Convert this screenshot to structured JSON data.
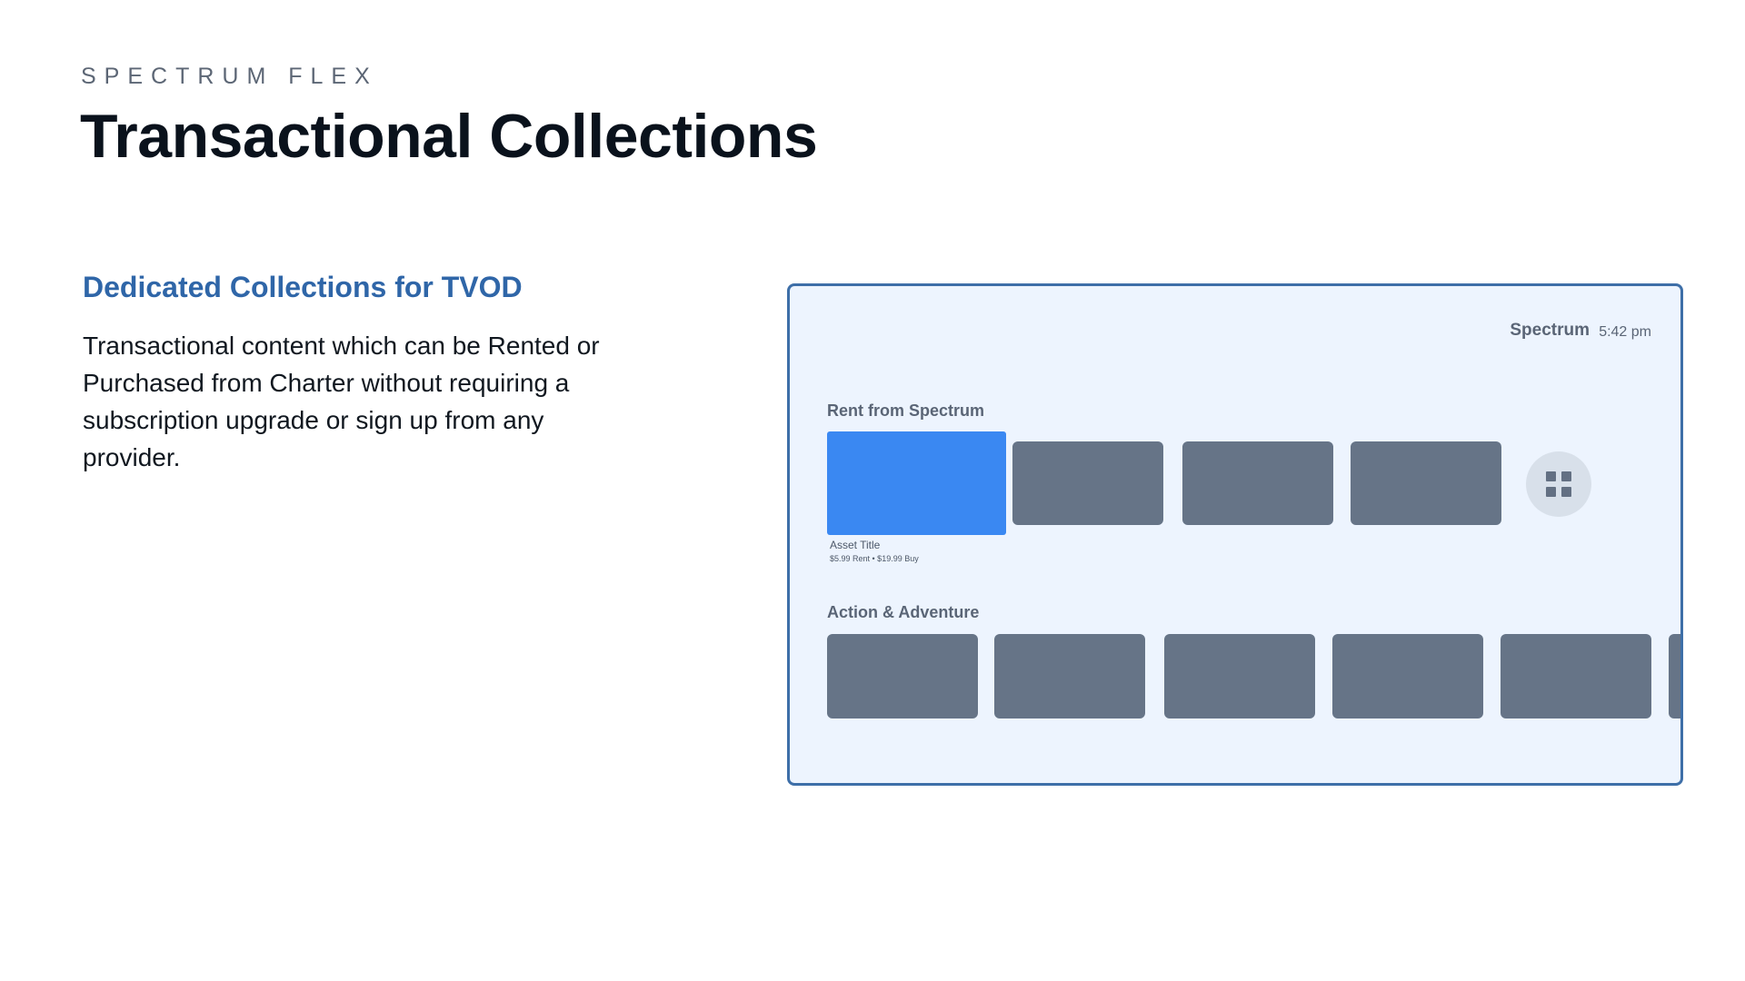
{
  "header": {
    "eyebrow": "SPECTRUM FLEX",
    "title": "Transactional Collections"
  },
  "content": {
    "subtitle": "Dedicated Collections for TVOD",
    "description": "Transactional content which can be Rented or Purchased from Charter without requiring a subscription upgrade or sign up from any provider."
  },
  "tv": {
    "brand": "Spectrum",
    "time": "5:42 pm",
    "rows": [
      {
        "title": "Rent from Spectrum",
        "focused_asset_title": "Asset Title",
        "focused_asset_price": "$5.99 Rent  •  $19.99 Buy"
      },
      {
        "title": "Action & Adventure"
      }
    ],
    "grid_button_icon": "grid-icon"
  },
  "colors": {
    "accent_blue": "#2f66a8",
    "focus_blue": "#3a88f2",
    "tile_gray": "#667487",
    "frame_bg": "#edf4fe"
  }
}
